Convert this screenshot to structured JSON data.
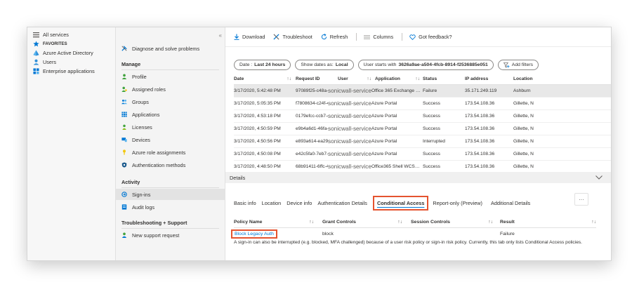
{
  "left_nav": {
    "items": [
      {
        "label": "All services",
        "icon": "list-icon"
      },
      {
        "label": "FAVORITES",
        "icon": "star-icon"
      },
      {
        "label": "Azure Active Directory",
        "icon": "azure-ad-icon"
      },
      {
        "label": "Users",
        "icon": "users-icon"
      },
      {
        "label": "Enterprise applications",
        "icon": "apps-grid-icon"
      }
    ]
  },
  "menu": {
    "collapse_glyph": "«",
    "diagnose": "Diagnose and solve problems",
    "manage_header": "Manage",
    "manage_items": [
      {
        "label": "Profile",
        "icon": "person-icon",
        "color": "#41a33d"
      },
      {
        "label": "Assigned roles",
        "icon": "roles-icon",
        "color": "#41a33d"
      },
      {
        "label": "Groups",
        "icon": "groups-icon",
        "color": "#0078d4"
      },
      {
        "label": "Applications",
        "icon": "apps-icon",
        "color": "#0078d4"
      },
      {
        "label": "Licenses",
        "icon": "license-icon",
        "color": "#41a33d"
      },
      {
        "label": "Devices",
        "icon": "devices-icon",
        "color": "#0078d4"
      },
      {
        "label": "Azure role assignments",
        "icon": "key-icon",
        "color": "#f2c811"
      },
      {
        "label": "Authentication methods",
        "icon": "shield-icon",
        "color": "#1c5a8c"
      }
    ],
    "activity_header": "Activity",
    "activity_items": [
      {
        "label": "Sign-ins",
        "icon": "signin-icon",
        "selected": true
      },
      {
        "label": "Audit logs",
        "icon": "audit-icon",
        "selected": false
      }
    ],
    "support_header": "Troubleshooting + Support",
    "support_items": [
      {
        "label": "New support request",
        "icon": "support-icon"
      }
    ]
  },
  "toolbar": {
    "download": "Download",
    "troubleshoot": "Troubleshoot",
    "refresh": "Refresh",
    "columns": "Columns",
    "feedback": "Got feedback?"
  },
  "filters": {
    "date_prefix": "Date :",
    "date_value": "Last 24 hours",
    "show_dates_prefix": "Show dates as:",
    "show_dates_value": "Local",
    "user_prefix": "User starts with",
    "user_value": "3626a9ae-a504-4fcb-8914-f2536885e051",
    "add_filters": "Add filters"
  },
  "grid": {
    "headers": {
      "date": "Date",
      "request_id": "Request ID",
      "user": "User",
      "application": "Application",
      "status": "Status",
      "ip": "IP address",
      "location": "Location"
    },
    "sort_glyph": "↑↓",
    "rows": [
      {
        "date": "3/17/2020, 5:42:48 PM",
        "request_id": "97089f25-c48a-485f-…",
        "user": "sonicwall-service-user",
        "application": "Office 365 Exchange …",
        "status": "Failure",
        "ip": "35.171.249.119",
        "location": "Ashburn",
        "selected": true
      },
      {
        "date": "3/17/2020, 5:05:35 PM",
        "request_id": "f7808634-c24f-49f7-…",
        "user": "sonicwall-service-user",
        "application": "Azure Portal",
        "status": "Success",
        "ip": "173.54.108.36",
        "location": "Gillette, N",
        "selected": false
      },
      {
        "date": "3/17/2020, 4:53:18 PM",
        "request_id": "0179efcc-ccb7-4111-…",
        "user": "sonicwall-service-user",
        "application": "Azure Portal",
        "status": "Success",
        "ip": "173.54.108.36",
        "location": "Gillette, N",
        "selected": false
      },
      {
        "date": "3/17/2020, 4:50:59 PM",
        "request_id": "e9b4a6d1-46fa-4b70-…",
        "user": "sonicwall-service-user",
        "application": "Azure Portal",
        "status": "Success",
        "ip": "173.54.108.36",
        "location": "Gillette, N",
        "selected": false
      },
      {
        "date": "3/17/2020, 4:50:56 PM",
        "request_id": "e893a614-ea29-4d7…",
        "user": "sonicwall-service-user",
        "application": "Azure Portal",
        "status": "Interrupted",
        "ip": "173.54.108.36",
        "location": "Gillette, N",
        "selected": false
      },
      {
        "date": "3/17/2020, 4:50:08 PM",
        "request_id": "e42c5fa0-7eb7-49db-…",
        "user": "sonicwall-service-user",
        "application": "Azure Portal",
        "status": "Success",
        "ip": "173.54.108.36",
        "location": "Gillette, N",
        "selected": false
      },
      {
        "date": "3/17/2020, 4:48:50 PM",
        "request_id": "68b91411-6ffc-4161-…",
        "user": "sonicwall-service-user",
        "application": "Office365 Shell WCS…",
        "status": "Success",
        "ip": "173.54.108.36",
        "location": "Gillette, N",
        "selected": false
      }
    ]
  },
  "details": {
    "label": "Details",
    "tabs": [
      "Basic info",
      "Location",
      "Device info",
      "Authentication Details",
      "Conditional Access",
      "Report-only (Preview)",
      "Additional Details"
    ],
    "active_tab": "Conditional Access",
    "more_glyph": "···"
  },
  "ca_table": {
    "headers": {
      "policy": "Policy Name",
      "grant": "Grant Controls",
      "session": "Session Controls",
      "result": "Result"
    },
    "row": {
      "policy": "Block Legacy Auth",
      "grant": "block",
      "session": "",
      "result": "Failure"
    },
    "note": "A sign-in can also be interrupted (e.g. blocked, MFA challenged) because of a user risk policy or sign-in risk policy. Currently, this tab only lists Conditional Access policies."
  },
  "colors": {
    "accent": "#0078d4",
    "highlight_box": "#e5532f",
    "selected_row": "#e8e8e8"
  }
}
